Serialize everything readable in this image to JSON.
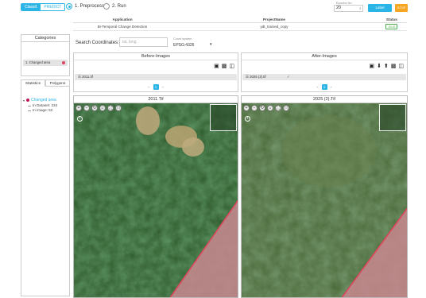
{
  "toolbar": {
    "mode_train": "Classif.",
    "mode_predict": "PREDICT",
    "step1": "1. Preprocess",
    "step2": "2. Run",
    "epochs_label": "Epochs No.",
    "epochs_value": "20",
    "train_button": "Label",
    "stop_button": "STOP"
  },
  "project_table": {
    "headers": [
      "Application",
      "ProjectName",
      "Status"
    ],
    "row": {
      "application": "Bi-Temporal Change Detection",
      "project": "ydt_trained_copy",
      "status": "IDLE"
    }
  },
  "categories": {
    "title": "Categories",
    "item": "1. Changed area",
    "item_color": "#e0435a"
  },
  "stats_tabs": {
    "statistics": "Statistics",
    "polygons": "Polygons"
  },
  "stats_tree": {
    "root": "Changed area",
    "dataset": "In Dataset: 234",
    "image": "In image: 52"
  },
  "search": {
    "label": "Search Coordinates:",
    "placeholder": "lat, long",
    "coord_system_label": "Coord system",
    "coord_system_value": "EPSG:4326"
  },
  "before": {
    "title": "Before-Images",
    "file": "2011.tif",
    "pages": [
      "«",
      "1",
      "»"
    ],
    "map_title": "2011.Tif"
  },
  "after": {
    "title": "After-Images",
    "file": "2025 (2).tif",
    "pages": [
      "«",
      "1",
      "»"
    ],
    "map_title": "2025 (2).Tif"
  },
  "colors": {
    "accent": "#2bb4e6",
    "stop": "#f5a623",
    "changed_area": "#e0435a"
  }
}
